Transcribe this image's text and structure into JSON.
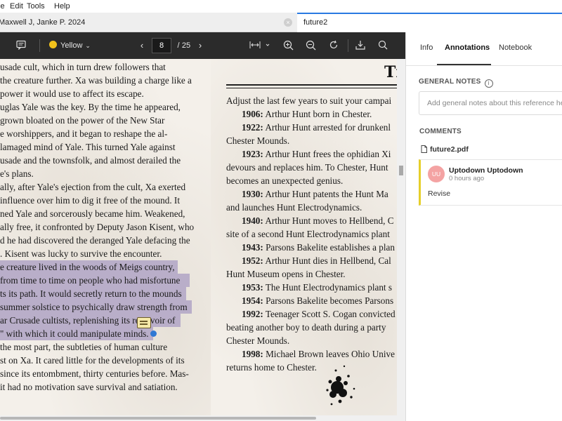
{
  "menubar": {
    "items": [
      "le",
      "Edit",
      "Tools",
      "Help"
    ]
  },
  "tabs": [
    {
      "label": "Maxwell J, Janke P. 2024",
      "close": "×"
    },
    {
      "label": "future2"
    }
  ],
  "toolbar": {
    "highlight_color": "Yellow",
    "highlight_color_hex": "#f2c21b",
    "current_page": "8",
    "page_separator": "/",
    "total_pages": "25"
  },
  "document": {
    "left_lines": [
      "usade cult, which in turn drew followers that",
      "the creature further. Xa was building a charge like a",
      "power it would use to affect its escape.",
      "uglas Yale was the key. By the time he appeared,",
      "grown bloated on the power of the New Star",
      "e worshippers, and it began to reshape the al-",
      "lamaged mind of Yale. This turned Yale against",
      "usade and the townsfolk, and almost derailed the",
      "e's plans.",
      "ally, after Yale's ejection from the cult, Xa exerted",
      "influence over him to dig it free of the mound. It",
      "ned Yale and sorcerously became him. Weakened,",
      "ally free, it confronted by Deputy Jason Kisent, who",
      "d he had discovered the deranged Yale defacing the",
      ". Kisent was lucky to survive the encounter.",
      "e creature lived in the woods of Meigs country,",
      "from time to time on people who had misfortune",
      "ts its path. It would secretly return to the mounds",
      "summer solstice to psychically draw strength from",
      "ar Crusade cultists, replenishing its reservoir of",
      "\" with which it could manipulate minds.",
      "the most part, the subtleties of human culture",
      "st on Xa. It cared little for the developments of its",
      "since its entombment, thirty centuries before. Mas-",
      "it had no motivation save survival and satiation."
    ],
    "right_title": "Ti",
    "right_lines": [
      {
        "bold": "",
        "text": "Adjust the last few years to suit your campai"
      },
      {
        "bold": "1906:",
        "text": " Arthur Hunt born in Chester."
      },
      {
        "bold": "1922:",
        "text": " Arthur Hunt arrested for drunkenl"
      },
      {
        "bold": "",
        "text": "Chester Mounds."
      },
      {
        "bold": "1923:",
        "text": " Arthur Hunt frees the ophidian Xi"
      },
      {
        "bold": "",
        "text": "devours and replaces him. To Chester, Hunt"
      },
      {
        "bold": "",
        "text": "becomes an unexpected genius."
      },
      {
        "bold": "1930:",
        "text": " Arthur Hunt patents the Hunt Ma"
      },
      {
        "bold": "",
        "text": "and launches Hunt Electrodynamics."
      },
      {
        "bold": "1940:",
        "text": " Arthur Hunt moves to Hellbend, C"
      },
      {
        "bold": "",
        "text": "site of a second Hunt Electrodynamics plant"
      },
      {
        "bold": "1943:",
        "text": " Parsons Bakelite establishes a plan"
      },
      {
        "bold": "1952:",
        "text": " Arthur Hunt dies in Hellbend, Cal"
      },
      {
        "bold": "",
        "text": "Hunt Museum opens in Chester."
      },
      {
        "bold": "1953:",
        "text": " The Hunt Electrodynamics plant s"
      },
      {
        "bold": "1954:",
        "text": " Parsons Bakelite becomes Parsons"
      },
      {
        "bold": "1992:",
        "text": " Teenager Scott S. Cogan convicted"
      },
      {
        "bold": "",
        "text": "beating another boy to death during a party"
      },
      {
        "bold": "",
        "text": "Chester Mounds."
      },
      {
        "bold": "1998:",
        "text": " Michael Brown leaves Ohio Unive"
      },
      {
        "bold": "",
        "text": "returns home to Chester."
      }
    ]
  },
  "panel": {
    "tabs": [
      "Info",
      "Annotations",
      "Notebook"
    ],
    "active_tab": "Annotations",
    "general_notes_label": "GENERAL NOTES",
    "general_notes_placeholder": "Add general notes about this reference here",
    "comments_label": "COMMENTS",
    "file_name": "future2.pdf",
    "comment": {
      "avatar_initials": "UU",
      "author": "Uptodown Uptodown",
      "time": "0 hours ago",
      "text": "Revise",
      "accent_color": "#e6cf2a"
    }
  }
}
